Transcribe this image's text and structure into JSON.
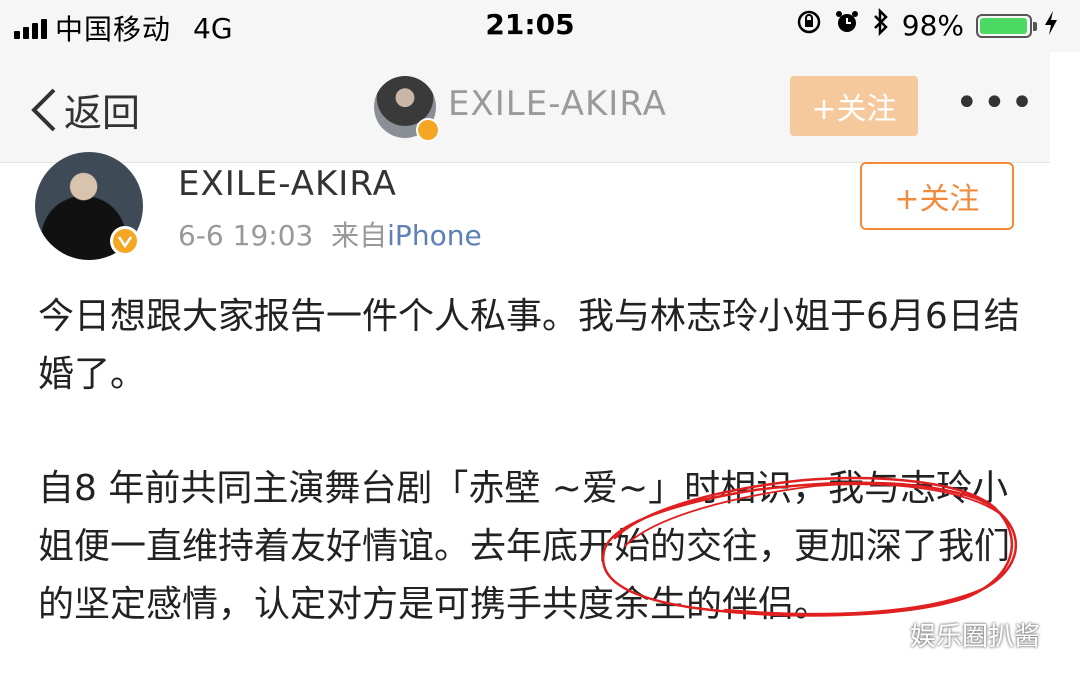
{
  "status_bar": {
    "carrier": "中国移动",
    "network": "4G",
    "time": "21:05",
    "battery_percent": "98%",
    "battery_level": 0.98,
    "icons": [
      "signal-icon",
      "rotation-lock-icon",
      "alarm-icon",
      "bluetooth-icon",
      "battery-icon",
      "charging-icon"
    ]
  },
  "nav": {
    "back_label": "返回",
    "title": "EXILE-AKIRA",
    "follow_label": "+关注",
    "more_label": "•••"
  },
  "post": {
    "author": "EXILE-AKIRA",
    "date": "6-6 19:03",
    "source_prefix": "来自",
    "source": "iPhone",
    "follow_label": "+关注",
    "paragraphs": [
      "今日想跟大家报告一件个人私事。我与林志玲小姐于6月6日结婚了。",
      "自8 年前共同主演舞台剧「赤壁 ~爱~」时相识，我与志玲小姐便一直维持着友好情谊。去年底开始的交往，更加深了我们的坚定感情，认定对方是可携手共度余生的伴侣。"
    ]
  },
  "watermark": "娱乐圈扒酱",
  "colors": {
    "follow_orange": "#f28a3c",
    "nav_follow_bg": "#f6c99c",
    "verified_badge": "#f5a623",
    "source_link": "#5d7fb5",
    "scribble": "#e02020"
  }
}
